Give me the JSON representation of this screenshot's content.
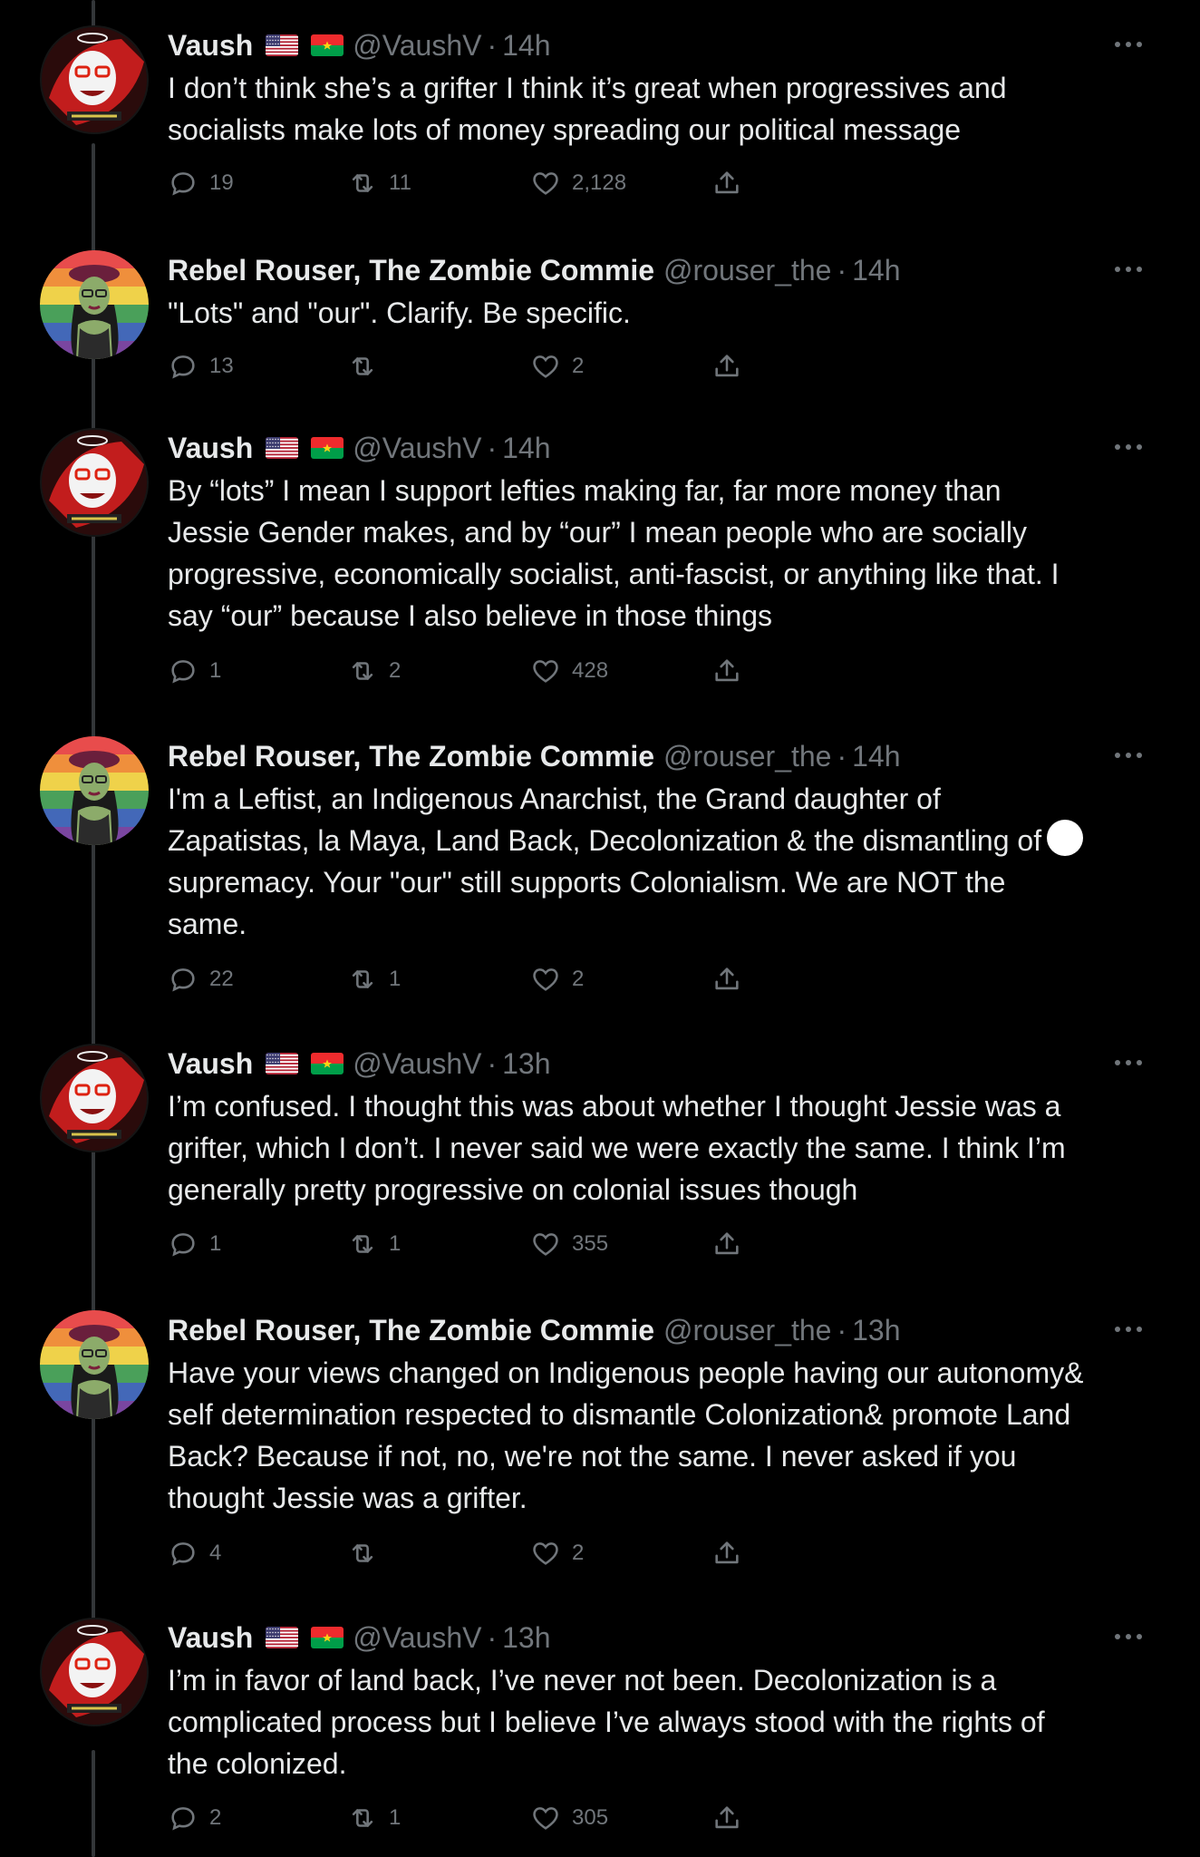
{
  "colors": {
    "background": "#000000",
    "text": "#e7e9ea",
    "muted": "#71767b",
    "thread_line": "#333639"
  },
  "icons": {
    "reply": "reply-icon",
    "retweet": "retweet-icon",
    "like": "like-icon",
    "share": "share-icon",
    "more": "more-icon"
  },
  "tweets": [
    {
      "author": "Vaush",
      "flags": [
        "us-flag",
        "burkina-faso-flag"
      ],
      "handle": "@VaushV",
      "dot": "·",
      "time": "14h",
      "text": "I don’t think she’s a grifter I think it’s great when progressives and\nsocialists make lots of money spreading our political message",
      "replies": "19",
      "retweets": "11",
      "likes": "2,128"
    },
    {
      "author": "Rebel Rouser, The Zombie Commie",
      "flags": [],
      "handle": "@rouser_the",
      "dot": "·",
      "time": "14h",
      "text": "\"Lots\" and \"our\". Clarify. Be specific.",
      "replies": "13",
      "retweets": "",
      "likes": "2"
    },
    {
      "author": "Vaush",
      "flags": [
        "us-flag",
        "burkina-faso-flag"
      ],
      "handle": "@VaushV",
      "dot": "·",
      "time": "14h",
      "text": "By “lots” I mean I support lefties making far, far more money than\nJessie Gender makes, and by “our” I mean people who are socially\nprogressive, economically socialist, anti-fascist, or anything like that. I\nsay “our” because I also believe in those things",
      "replies": "1",
      "retweets": "2",
      "likes": "428"
    },
    {
      "author": "Rebel Rouser, The Zombie Commie",
      "flags": [],
      "handle": "@rouser_the",
      "dot": "·",
      "time": "14h",
      "text": "I'm a Leftist, an Indigenous Anarchist, the Grand daughter of\nZapatistas, la Maya, Land Back, Decolonization & the dismantling of",
      "text_cont": "supremacy. Your \"our\" still supports Colonialism. We are NOT the\nsame.",
      "inline_emoji": "white-circle-emoji",
      "replies": "22",
      "retweets": "1",
      "likes": "2"
    },
    {
      "author": "Vaush",
      "flags": [
        "us-flag",
        "burkina-faso-flag"
      ],
      "handle": "@VaushV",
      "dot": "·",
      "time": "13h",
      "text": "I’m confused. I thought this was about whether I thought Jessie was a\ngrifter, which I don’t. I never said we were exactly the same. I think I’m\ngenerally pretty progressive on colonial issues though",
      "replies": "1",
      "retweets": "1",
      "likes": "355"
    },
    {
      "author": "Rebel Rouser, The Zombie Commie",
      "flags": [],
      "handle": "@rouser_the",
      "dot": "·",
      "time": "13h",
      "text": "Have your views changed on Indigenous people having our autonomy&\nself determination respected to dismantle Colonization& promote Land\nBack? Because if not, no, we're not the same. I never asked if you\nthought Jessie was a grifter.",
      "replies": "4",
      "retweets": "",
      "likes": "2"
    },
    {
      "author": "Vaush",
      "flags": [
        "us-flag",
        "burkina-faso-flag"
      ],
      "handle": "@VaushV",
      "dot": "·",
      "time": "13h",
      "text": "I’m in favor of land back, I’ve never not been. Decolonization is a\ncomplicated process but I believe I’ve always stood with the rights of\nthe colonized.",
      "replies": "2",
      "retweets": "1",
      "likes": "305"
    }
  ]
}
